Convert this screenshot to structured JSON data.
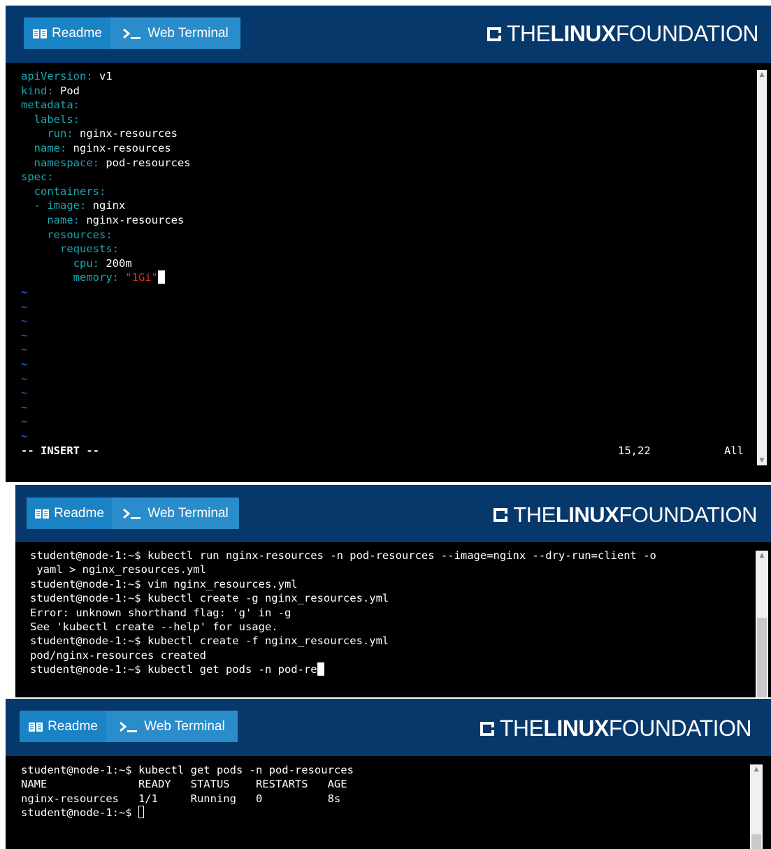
{
  "tabs": {
    "readme": "Readme",
    "terminal": "Web Terminal"
  },
  "brand": {
    "the": "THE",
    "linux": "LINUX",
    "foundation": "FOUNDATION"
  },
  "icons": {
    "readme": "book-icon",
    "terminal": "prompt-icon"
  },
  "colors": {
    "header_bg": "#07386b",
    "tab_bg": "#1a83c5",
    "terminal_bg": "#000000",
    "yaml_key": "#19a6b0",
    "yaml_string": "#d92a2a",
    "vim_tilde": "#2a6fd6"
  },
  "editor": {
    "yaml": [
      {
        "key": "apiVersion:",
        "value": " v1"
      },
      {
        "key": "kind:",
        "value": " Pod"
      },
      {
        "key": "metadata:",
        "value": ""
      },
      {
        "key": "  labels:",
        "value": ""
      },
      {
        "key": "    run:",
        "value": " nginx-resources"
      },
      {
        "key": "  name:",
        "value": " nginx-resources"
      },
      {
        "key": "  namespace:",
        "value": " pod-resources"
      },
      {
        "key": "spec:",
        "value": ""
      },
      {
        "key": "  containers:",
        "value": ""
      },
      {
        "key": "  - image:",
        "value": " nginx"
      },
      {
        "key": "    name:",
        "value": " nginx-resources"
      },
      {
        "key": "    resources:",
        "value": ""
      },
      {
        "key": "      requests:",
        "value": ""
      },
      {
        "key": "        cpu:",
        "value": " 200m"
      },
      {
        "key": "        memory:",
        "value": "",
        "string": " \"1Gi\""
      }
    ],
    "tilde": "~",
    "mode": "-- INSERT --",
    "position": "15,22",
    "scroll": "All"
  },
  "terminal2": {
    "lines": [
      "student@node-1:~$ kubectl run nginx-resources -n pod-resources --image=nginx --dry-run=client -o",
      " yaml > nginx_resources.yml",
      "student@node-1:~$ vim nginx_resources.yml",
      "student@node-1:~$ kubectl create -g nginx_resources.yml",
      "Error: unknown shorthand flag: 'g' in -g",
      "See 'kubectl create --help' for usage.",
      "student@node-1:~$ kubectl create -f nginx_resources.yml",
      "pod/nginx-resources created",
      "student@node-1:~$ kubectl get pods -n pod-re"
    ]
  },
  "terminal3": {
    "lines": [
      "student@node-1:~$ kubectl get pods -n pod-resources",
      "NAME              READY   STATUS    RESTARTS   AGE",
      "nginx-resources   1/1     Running   0          8s",
      "student@node-1:~$ "
    ]
  }
}
